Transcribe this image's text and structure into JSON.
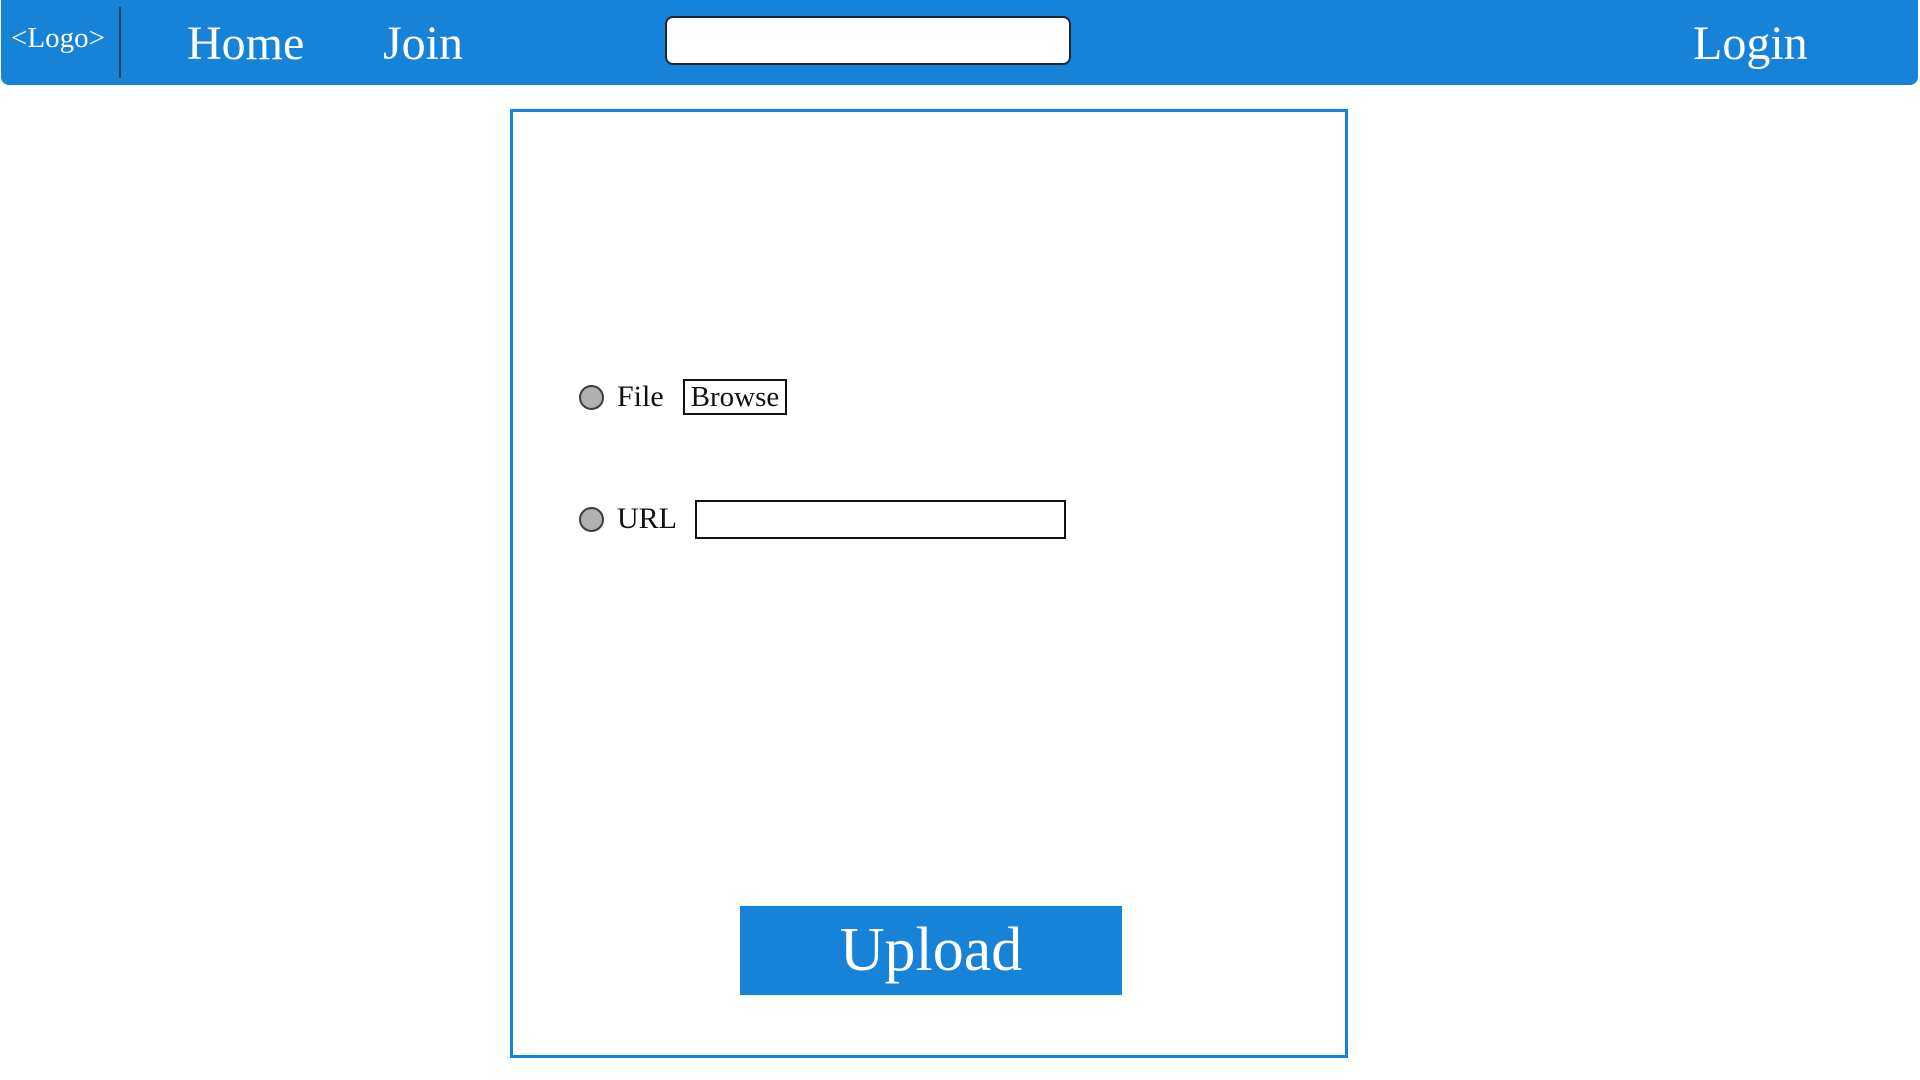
{
  "header": {
    "logo_text": "<Logo>",
    "nav": {
      "home_label": "Home",
      "join_label": "Join",
      "login_label": "Login"
    },
    "search": {
      "value": "",
      "placeholder": ""
    }
  },
  "upload_form": {
    "file_option": {
      "label": "File",
      "selected": false,
      "browse_label": "Browse"
    },
    "url_option": {
      "label": "URL",
      "selected": false,
      "value": "",
      "placeholder": ""
    },
    "upload_label": "Upload"
  },
  "colors": {
    "brand_blue": "#1683d8",
    "radio_fill": "#b0b0b0",
    "text_dark": "#111111"
  }
}
